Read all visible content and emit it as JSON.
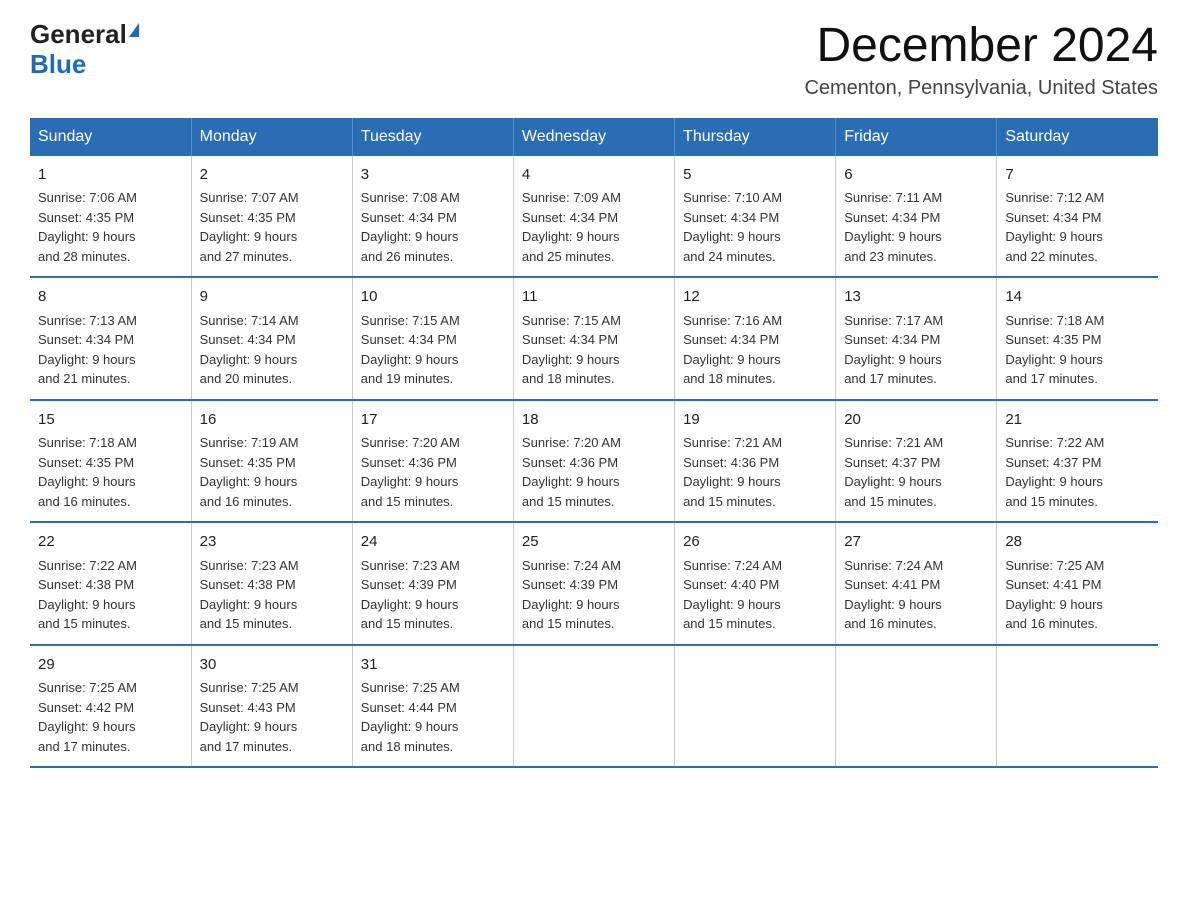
{
  "logo": {
    "general": "General",
    "triangle": "▶",
    "blue": "Blue"
  },
  "title": "December 2024",
  "subtitle": "Cementon, Pennsylvania, United States",
  "weekdays": [
    "Sunday",
    "Monday",
    "Tuesday",
    "Wednesday",
    "Thursday",
    "Friday",
    "Saturday"
  ],
  "weeks": [
    [
      {
        "day": "1",
        "sunrise": "7:06 AM",
        "sunset": "4:35 PM",
        "daylight": "9 hours and 28 minutes."
      },
      {
        "day": "2",
        "sunrise": "7:07 AM",
        "sunset": "4:35 PM",
        "daylight": "9 hours and 27 minutes."
      },
      {
        "day": "3",
        "sunrise": "7:08 AM",
        "sunset": "4:34 PM",
        "daylight": "9 hours and 26 minutes."
      },
      {
        "day": "4",
        "sunrise": "7:09 AM",
        "sunset": "4:34 PM",
        "daylight": "9 hours and 25 minutes."
      },
      {
        "day": "5",
        "sunrise": "7:10 AM",
        "sunset": "4:34 PM",
        "daylight": "9 hours and 24 minutes."
      },
      {
        "day": "6",
        "sunrise": "7:11 AM",
        "sunset": "4:34 PM",
        "daylight": "9 hours and 23 minutes."
      },
      {
        "day": "7",
        "sunrise": "7:12 AM",
        "sunset": "4:34 PM",
        "daylight": "9 hours and 22 minutes."
      }
    ],
    [
      {
        "day": "8",
        "sunrise": "7:13 AM",
        "sunset": "4:34 PM",
        "daylight": "9 hours and 21 minutes."
      },
      {
        "day": "9",
        "sunrise": "7:14 AM",
        "sunset": "4:34 PM",
        "daylight": "9 hours and 20 minutes."
      },
      {
        "day": "10",
        "sunrise": "7:15 AM",
        "sunset": "4:34 PM",
        "daylight": "9 hours and 19 minutes."
      },
      {
        "day": "11",
        "sunrise": "7:15 AM",
        "sunset": "4:34 PM",
        "daylight": "9 hours and 18 minutes."
      },
      {
        "day": "12",
        "sunrise": "7:16 AM",
        "sunset": "4:34 PM",
        "daylight": "9 hours and 18 minutes."
      },
      {
        "day": "13",
        "sunrise": "7:17 AM",
        "sunset": "4:34 PM",
        "daylight": "9 hours and 17 minutes."
      },
      {
        "day": "14",
        "sunrise": "7:18 AM",
        "sunset": "4:35 PM",
        "daylight": "9 hours and 17 minutes."
      }
    ],
    [
      {
        "day": "15",
        "sunrise": "7:18 AM",
        "sunset": "4:35 PM",
        "daylight": "9 hours and 16 minutes."
      },
      {
        "day": "16",
        "sunrise": "7:19 AM",
        "sunset": "4:35 PM",
        "daylight": "9 hours and 16 minutes."
      },
      {
        "day": "17",
        "sunrise": "7:20 AM",
        "sunset": "4:36 PM",
        "daylight": "9 hours and 15 minutes."
      },
      {
        "day": "18",
        "sunrise": "7:20 AM",
        "sunset": "4:36 PM",
        "daylight": "9 hours and 15 minutes."
      },
      {
        "day": "19",
        "sunrise": "7:21 AM",
        "sunset": "4:36 PM",
        "daylight": "9 hours and 15 minutes."
      },
      {
        "day": "20",
        "sunrise": "7:21 AM",
        "sunset": "4:37 PM",
        "daylight": "9 hours and 15 minutes."
      },
      {
        "day": "21",
        "sunrise": "7:22 AM",
        "sunset": "4:37 PM",
        "daylight": "9 hours and 15 minutes."
      }
    ],
    [
      {
        "day": "22",
        "sunrise": "7:22 AM",
        "sunset": "4:38 PM",
        "daylight": "9 hours and 15 minutes."
      },
      {
        "day": "23",
        "sunrise": "7:23 AM",
        "sunset": "4:38 PM",
        "daylight": "9 hours and 15 minutes."
      },
      {
        "day": "24",
        "sunrise": "7:23 AM",
        "sunset": "4:39 PM",
        "daylight": "9 hours and 15 minutes."
      },
      {
        "day": "25",
        "sunrise": "7:24 AM",
        "sunset": "4:39 PM",
        "daylight": "9 hours and 15 minutes."
      },
      {
        "day": "26",
        "sunrise": "7:24 AM",
        "sunset": "4:40 PM",
        "daylight": "9 hours and 15 minutes."
      },
      {
        "day": "27",
        "sunrise": "7:24 AM",
        "sunset": "4:41 PM",
        "daylight": "9 hours and 16 minutes."
      },
      {
        "day": "28",
        "sunrise": "7:25 AM",
        "sunset": "4:41 PM",
        "daylight": "9 hours and 16 minutes."
      }
    ],
    [
      {
        "day": "29",
        "sunrise": "7:25 AM",
        "sunset": "4:42 PM",
        "daylight": "9 hours and 17 minutes."
      },
      {
        "day": "30",
        "sunrise": "7:25 AM",
        "sunset": "4:43 PM",
        "daylight": "9 hours and 17 minutes."
      },
      {
        "day": "31",
        "sunrise": "7:25 AM",
        "sunset": "4:44 PM",
        "daylight": "9 hours and 18 minutes."
      },
      null,
      null,
      null,
      null
    ]
  ],
  "labels": {
    "sunrise_prefix": "Sunrise: ",
    "sunset_prefix": "Sunset: ",
    "daylight_prefix": "Daylight: "
  }
}
